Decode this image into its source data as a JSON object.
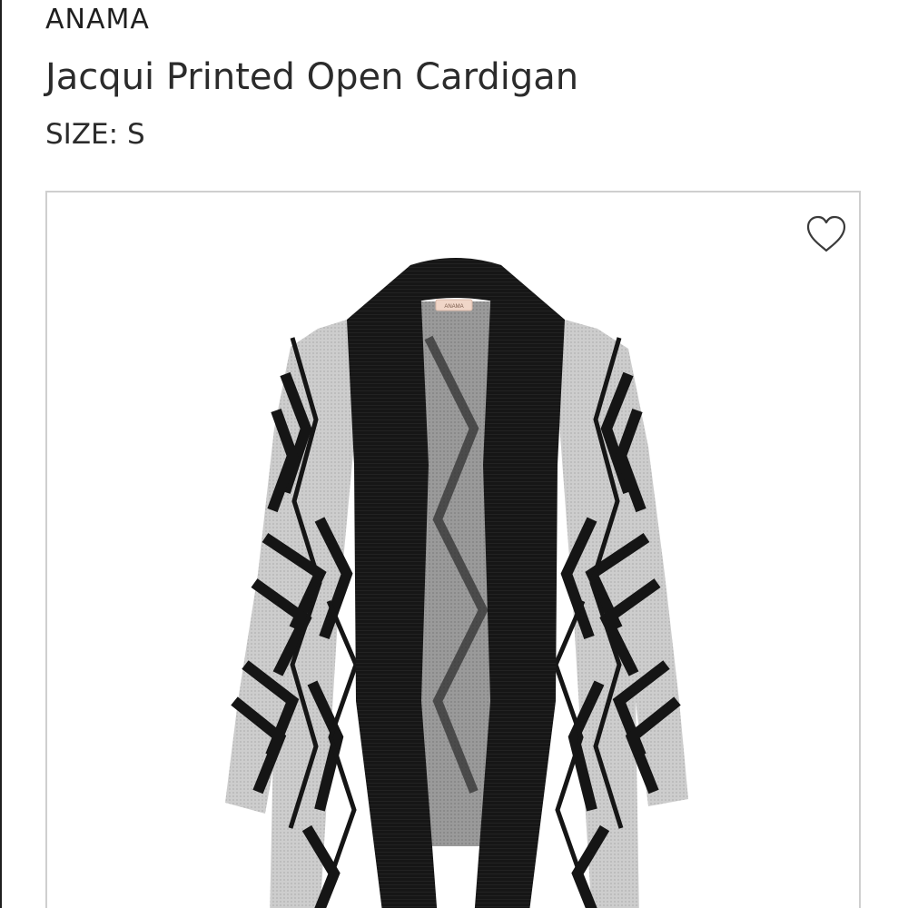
{
  "product": {
    "brand": "ANAMA",
    "name": "Jacqui Printed Open Cardigan",
    "size_label": "SIZE: S",
    "garment_tag": "ANAMA"
  },
  "icons": {
    "favorite": "heart-outline-icon"
  },
  "colors": {
    "text": "#2b2b2b",
    "card_border": "#cfcfcf",
    "knit_black": "#151515",
    "knit_grey": "#cdcdcd"
  }
}
